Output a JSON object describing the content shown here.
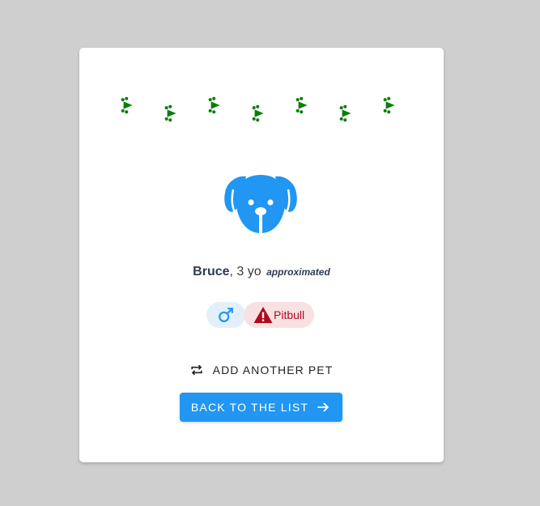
{
  "paws": {
    "icon": "paw-icon",
    "color": "#0a7d0a",
    "count": 7
  },
  "avatar": {
    "icon": "dog-face-icon",
    "color": "#2196f3"
  },
  "pet": {
    "name": "Bruce",
    "age_text": ", 3 yo",
    "approx_label": "approximated",
    "gender_icon": "male-symbol-icon",
    "breed": "Pitbull",
    "breed_icon": "warning-icon",
    "breed_color": "#b00a1e"
  },
  "actions": {
    "add_another_label": "ADD ANOTHER PET",
    "add_another_icon": "repeat-icon",
    "back_label": "BACK TO THE LIST",
    "back_icon": "arrow-right-icon",
    "accent": "#2196f3"
  }
}
